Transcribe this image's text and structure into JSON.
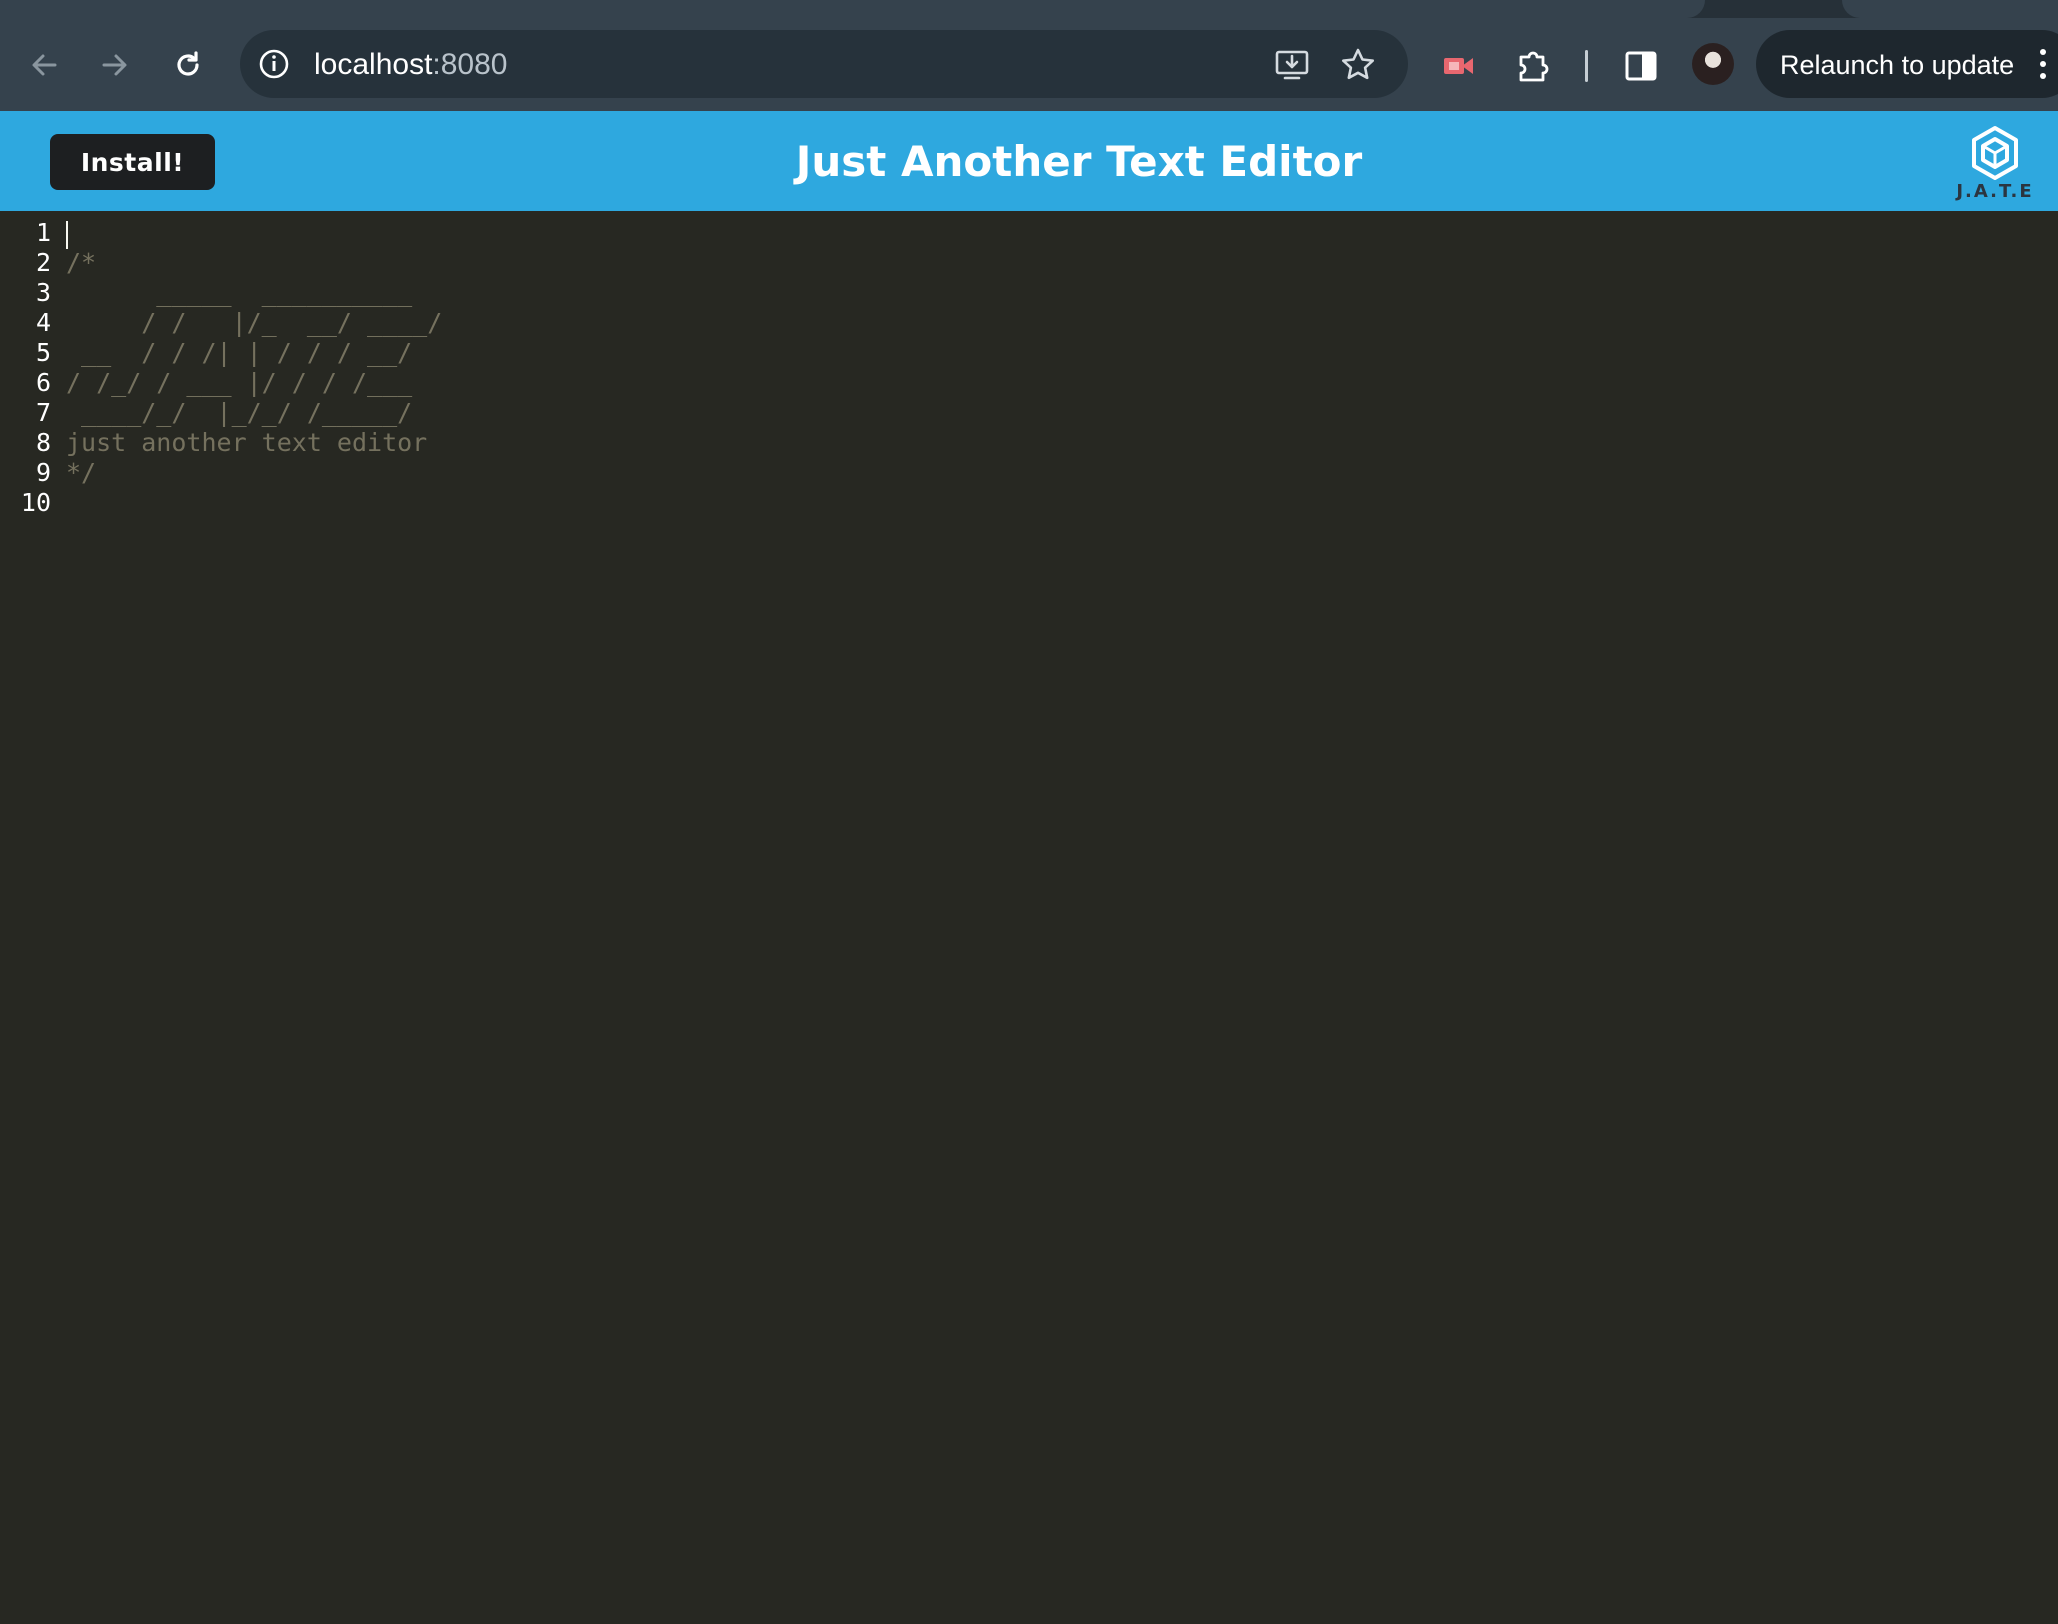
{
  "browser": {
    "url_host": "localhost",
    "url_port": ":8080",
    "relaunch_label": "Relaunch to update",
    "icons": [
      "back-arrow-icon",
      "forward-arrow-icon",
      "reload-icon",
      "info-icon",
      "install-app-icon",
      "bookmark-star-icon",
      "extension-red-icon",
      "puzzle-extensions-icon",
      "side-panel-icon",
      "avatar",
      "kebab-menu-icon"
    ]
  },
  "app": {
    "install_label": "Install!",
    "title": "Just Another Text Editor",
    "logo_text": "J.A.T.E",
    "brand_color": "#2ea8df"
  },
  "editor": {
    "background": "#272822",
    "line_numbers": [
      "1",
      "2",
      "3",
      "4",
      "5",
      "6",
      "7",
      "8",
      "9",
      "10"
    ],
    "lines": [
      "",
      "/*",
      "      _____  __________",
      "     / /   |/_  __/ ____/",
      " __  / / /| | / / / __/",
      "/ /_/ / ___ |/ / / /___",
      " ____/_/  |_/_/ /_____/",
      "just another text editor",
      "*/",
      ""
    ]
  }
}
